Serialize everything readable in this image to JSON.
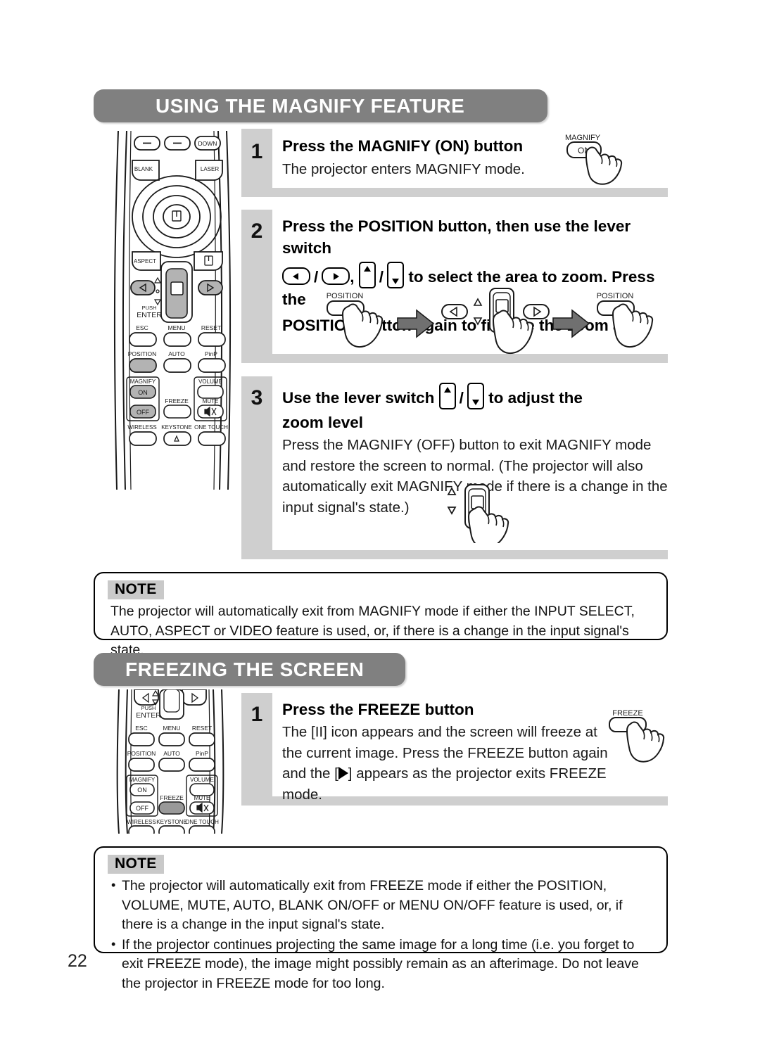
{
  "page": {
    "number": "22"
  },
  "sections": [
    {
      "id": "magnify",
      "title": "USING THE MAGNIFY FEATURE",
      "steps": [
        {
          "number": "1",
          "title": "Press the MAGNIFY (ON) button",
          "text": "The projector enters MAGNIFY mode.",
          "callout_label": "MAGNIFY",
          "callout_button": "ON"
        },
        {
          "number": "2",
          "title_line1": "Press the POSITION button, then use the lever switch",
          "title_mid_suffix": "to select the area to zoom. Press the",
          "title_line3": "POSITION button again to finalize the zoom area.",
          "diagram": {
            "first_label": "POSITION",
            "last_label": "POSITION"
          }
        },
        {
          "number": "3",
          "title_prefix": "Use the lever switch",
          "title_suffix": "to adjust the",
          "title_line2": "zoom level",
          "text": "Press the MAGNIFY (OFF) button to exit MAGNIFY mode and restore the screen to normal. (The projector will also automatically exit MAGNIFY mode if there is a change in the input signal's state.)"
        }
      ],
      "note": {
        "tag": "NOTE",
        "lines": [
          "The projector will automatically exit from MAGNIFY mode if either the INPUT SELECT,",
          "AUTO, ASPECT or VIDEO feature is used, or, if there is a change in the input signal's state."
        ]
      }
    },
    {
      "id": "freeze",
      "title": "FREEZING THE SCREEN",
      "steps": [
        {
          "number": "1",
          "title": "Press the FREEZE button",
          "text_a": "The [II] icon appears and the screen will freeze at the current image. Press the FREEZE button again and the [",
          "text_b": "] appears as the projector exits FREEZE mode.",
          "callout_button": "FREEZE"
        }
      ],
      "note": {
        "tag": "NOTE",
        "bullets": [
          "The projector will automatically exit from FREEZE mode if either the POSITION, VOLUME, MUTE, AUTO, BLANK ON/OFF or MENU ON/OFF feature is used, or, if there is a change in the input signal's state.",
          "If the projector continues projecting the same image for a long time (i.e. you forget to exit FREEZE mode), the image might possibly remain as an afterimage. Do not leave the projector in FREEZE mode for too long."
        ]
      }
    }
  ],
  "remote_top": {
    "keys": [
      "DOWN",
      "BLANK",
      "LASER",
      "ASPECT"
    ]
  },
  "remote_keypad": {
    "rows": [
      [
        "ESC",
        "MENU",
        "RESET"
      ],
      [
        "POSITION",
        "AUTO",
        "PinP"
      ]
    ],
    "push_enter_line1": "PUSH",
    "push_enter_line2": "ENTER",
    "magnify_group": {
      "label": "MAGNIFY",
      "on": "ON",
      "off": "OFF"
    },
    "freeze_label": "FREEZE",
    "volume_label": "VOLUME",
    "mute_label": "MUTE",
    "bottom_row": [
      "WIRELESS",
      "KEYSTONE",
      "ONE TOUCH"
    ]
  },
  "colors": {
    "header_gray": "#808080",
    "panel_gray": "#cfcfcf",
    "note_tag_gray": "#c9c9c9",
    "arrow_gray": "#707070",
    "key_highlight": "#b3b3b3"
  }
}
